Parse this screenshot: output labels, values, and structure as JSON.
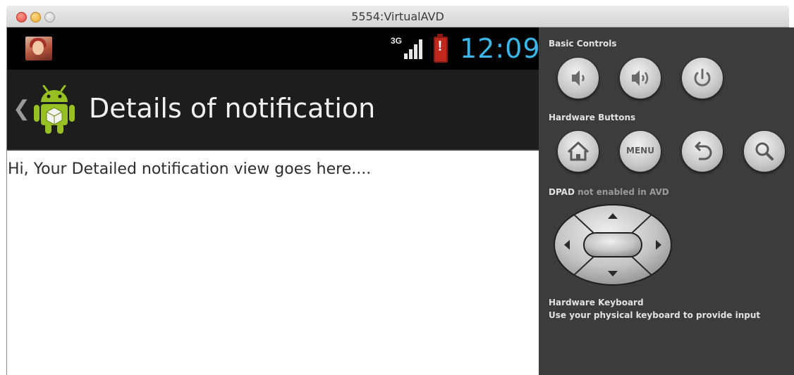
{
  "window": {
    "title": "5554:VirtualAVD"
  },
  "statusbar": {
    "network": "3G",
    "clock": "12:09"
  },
  "actionbar": {
    "title": "Details of notification"
  },
  "content": {
    "text": "Hi, Your Detailed notification view goes here...."
  },
  "controls": {
    "basic_label": "Basic Controls",
    "hardware_label": "Hardware Buttons",
    "menu_label": "MENU",
    "dpad_label": "DPAD",
    "dpad_note": "not enabled in AVD",
    "keyboard_title": "Hardware Keyboard",
    "keyboard_desc": "Use your physical keyboard to provide input"
  },
  "icons": {
    "basic": [
      "volume-down-icon",
      "volume-up-icon",
      "power-icon"
    ],
    "hardware": [
      "home-icon",
      "menu-button",
      "back-icon",
      "search-icon"
    ]
  },
  "colors": {
    "clock": "#39b7e8",
    "panel": "#3c3c3c",
    "actionbar": "#1d1d1d",
    "battery": "#c0271d",
    "android_green": "#97c024"
  }
}
